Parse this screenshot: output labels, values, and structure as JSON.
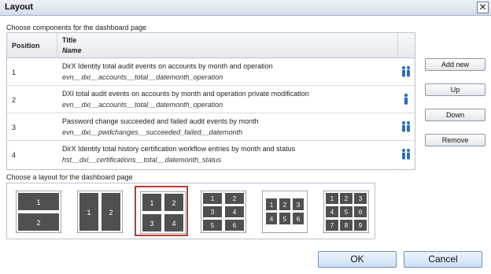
{
  "window": {
    "title": "Layout",
    "close_glyph": "✕"
  },
  "components": {
    "label": "Choose components for the dashboard page",
    "headers": {
      "position": "Position",
      "title": "Title",
      "name": "Name"
    },
    "rows": [
      {
        "position": "1",
        "title": "DirX Identity total audit events on accounts by month and operation",
        "name": "evn__dxi__accounts__total__datemonth_operation",
        "icon": "user-group-icon"
      },
      {
        "position": "2",
        "title": "DXI total audit events on accounts by month and operation private modification",
        "name": "evn__dxi__accounts__total__datemonth_operation",
        "icon": "user-icon"
      },
      {
        "position": "3",
        "title": "Password change succeeded and failed audit events by month",
        "name": "evn__dxi__pwdchanges__succeeded_failed__datemonth",
        "icon": "user-group-icon"
      },
      {
        "position": "4",
        "title": "DirX Identity total history certification workflow entries by month and status",
        "name": "hst__dxi__certifications__total__datemonth_status",
        "icon": "user-group-icon"
      }
    ]
  },
  "side_buttons": {
    "add_new": "Add new",
    "up": "Up",
    "down": "Down",
    "remove": "Remove"
  },
  "layouts": {
    "label": "Choose a layout for the dashboard page",
    "selected_index": 2,
    "options": [
      {
        "id": "layout-1x2-rows",
        "cells": [
          "1",
          "2"
        ]
      },
      {
        "id": "layout-2x1-cols",
        "cells": [
          "1",
          "2"
        ]
      },
      {
        "id": "layout-2x2",
        "cells": [
          "1",
          "2",
          "3",
          "4"
        ]
      },
      {
        "id": "layout-3x2",
        "cells": [
          "1",
          "2",
          "3",
          "4",
          "5",
          "6"
        ]
      },
      {
        "id": "layout-2x3",
        "cells": [
          "1",
          "2",
          "3",
          "4",
          "5",
          "6"
        ]
      },
      {
        "id": "layout-3x3",
        "cells": [
          "1",
          "2",
          "3",
          "4",
          "5",
          "6",
          "7",
          "8",
          "9"
        ]
      }
    ]
  },
  "footer": {
    "ok": "OK",
    "cancel": "Cancel"
  },
  "colors": {
    "selected_border": "#c0392b",
    "tile_dark": "#505050",
    "icon_blue": "#2a6fb5"
  }
}
